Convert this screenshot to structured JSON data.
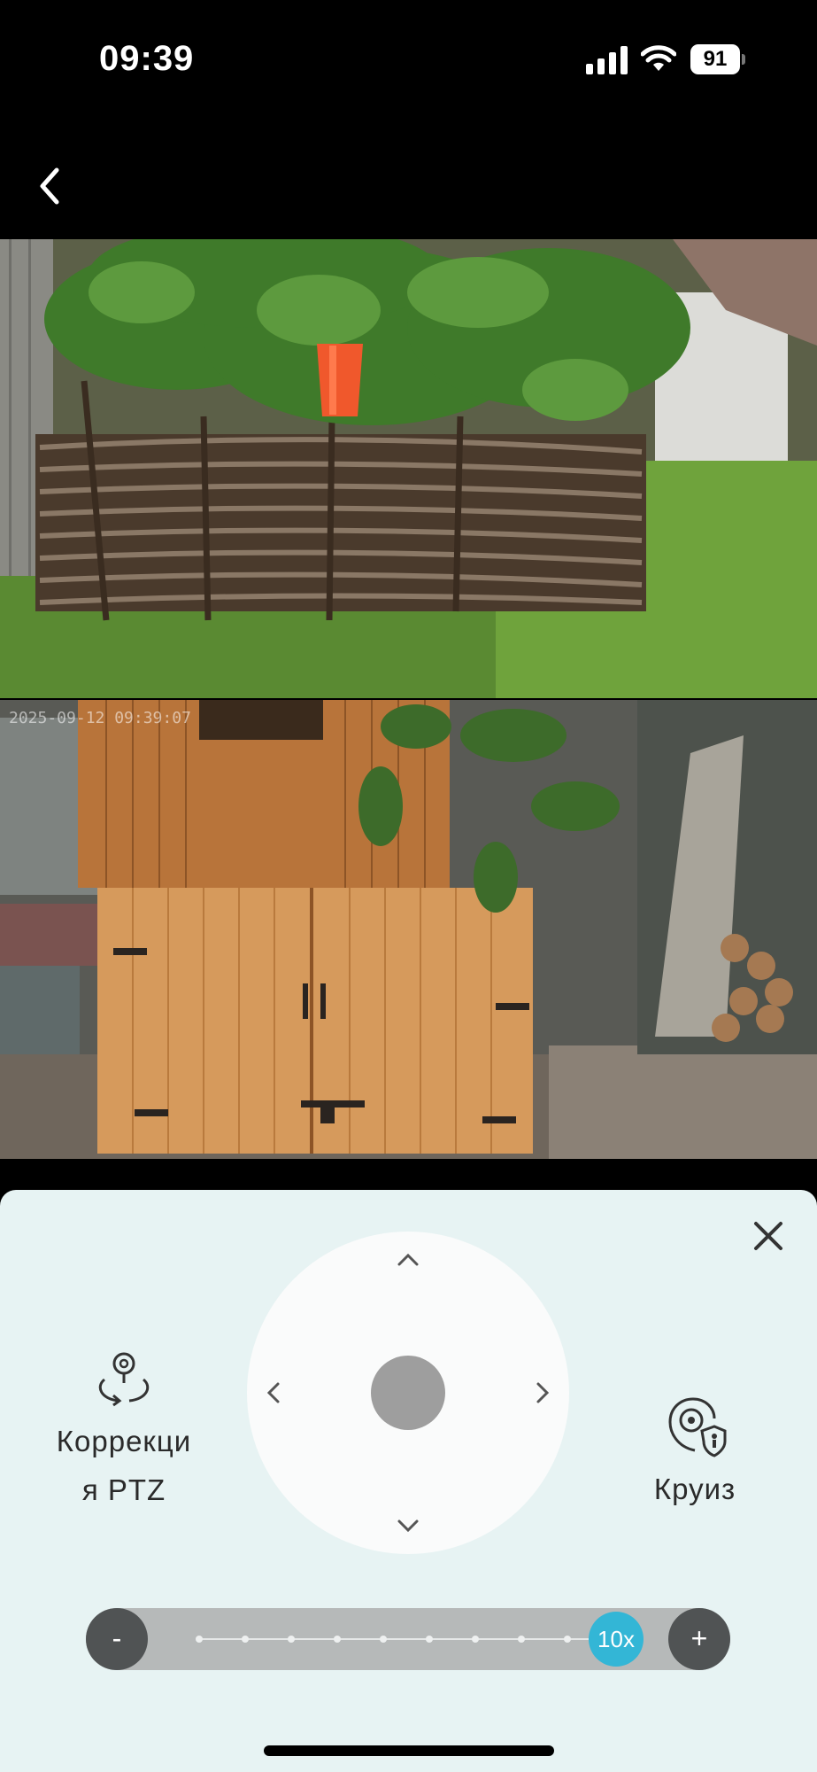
{
  "status_bar": {
    "time": "09:39",
    "battery": "91",
    "icons": [
      "cellular-signal-icon",
      "wifi-icon",
      "battery-icon"
    ]
  },
  "nav": {
    "back_icon": "chevron-left-icon"
  },
  "video": {
    "osd_timestamp": "2025-09-12 09:39:07",
    "views": [
      "camera-view-top",
      "camera-view-bottom"
    ]
  },
  "panel": {
    "close_icon": "close-icon",
    "ptz_correction": {
      "label_line1": "Коррекци",
      "label_line2": "я PTZ",
      "icon": "ptz-correction-icon"
    },
    "cruise": {
      "label": "Круиз",
      "icon": "cruise-icon"
    },
    "joystick": {
      "icons": [
        "chevron-up-icon",
        "chevron-down-icon",
        "chevron-left-icon",
        "chevron-right-icon"
      ]
    },
    "zoom": {
      "minus": "-",
      "plus": "+",
      "value": "10x",
      "level_fraction": 1.0
    }
  },
  "colors": {
    "panel_bg": "#e7f3f3",
    "zoom_thumb": "#33b6d6",
    "zoom_track": "#b6b9b9",
    "zoom_button": "#505354"
  }
}
